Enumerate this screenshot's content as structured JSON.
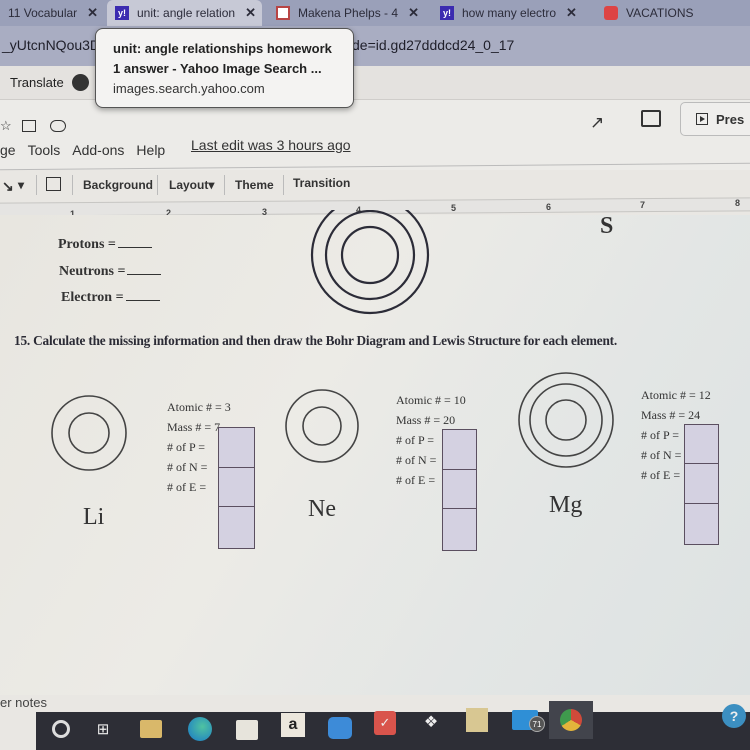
{
  "browser": {
    "tabs": [
      {
        "label": "11 Vocabular",
        "icon": "docs-icon",
        "active": false
      },
      {
        "label": "unit: angle relation",
        "icon": "yahoo-icon",
        "active": true
      },
      {
        "label": "Makena Phelps - 4",
        "icon": "slides-icon",
        "active": false
      },
      {
        "label": "how many electro",
        "icon": "yahoo-icon",
        "active": false
      },
      {
        "label": "VACATIONS",
        "icon": "red-icon",
        "active": false
      }
    ],
    "url_left": "_yUtcnNQou3D",
    "url_right": "de=id.gd27dddcd24_0_17",
    "bookmark_translate": "Translate",
    "tooltip": {
      "title": "unit: angle relationships homework",
      "subtitle": "1 answer - Yahoo Image Search ...",
      "domain": "images.search.yahoo.com"
    }
  },
  "docs": {
    "menu": [
      "ge",
      "Tools",
      "Add-ons",
      "Help"
    ],
    "last_edit": "Last edit was 3 hours ago",
    "present_label": "Pres",
    "toolbar": {
      "background": "Background",
      "layout": "Layout",
      "theme": "Theme",
      "transition": "Transition"
    },
    "ruler_numbers": [
      "1",
      "2",
      "3",
      "4",
      "5",
      "6",
      "7",
      "8"
    ]
  },
  "slide": {
    "top_element": {
      "symbol": "S",
      "protons": "Protons =",
      "neutrons": "Neutrons =",
      "electron": "Electron ="
    },
    "instruction": "15. Calculate the missing information and then draw the Bohr Diagram and Lewis Structure for each element.",
    "elements": [
      {
        "symbol": "Li",
        "atomic": "Atomic # = 3",
        "mass": "Mass # = 7",
        "p": "# of P =",
        "n": "# of N =",
        "e": "# of E =",
        "shells": 2
      },
      {
        "symbol": "Ne",
        "atomic": "Atomic # = 10",
        "mass": "Mass # = 20",
        "p": "# of P =",
        "n": "# of N =",
        "e": "# of E =",
        "shells": 2
      },
      {
        "symbol": "Mg",
        "atomic": "Atomic # = 12",
        "mass": "Mass # = 24",
        "p": "# of P =",
        "n": "# of N =",
        "e": "# of E =",
        "shells": 3
      }
    ],
    "speaker_notes": "er notes"
  },
  "taskbar": {
    "icons": [
      "cortana-icon",
      "task-view-icon",
      "file-explorer-icon",
      "edge-icon",
      "store-icon",
      "amazon-icon",
      "zoom-icon",
      "vivaldi-icon",
      "dropbox-icon",
      "app-icon",
      "mail-icon",
      "chrome-icon",
      "help-icon"
    ],
    "mail_badge": "71",
    "amazon_label": "a"
  }
}
